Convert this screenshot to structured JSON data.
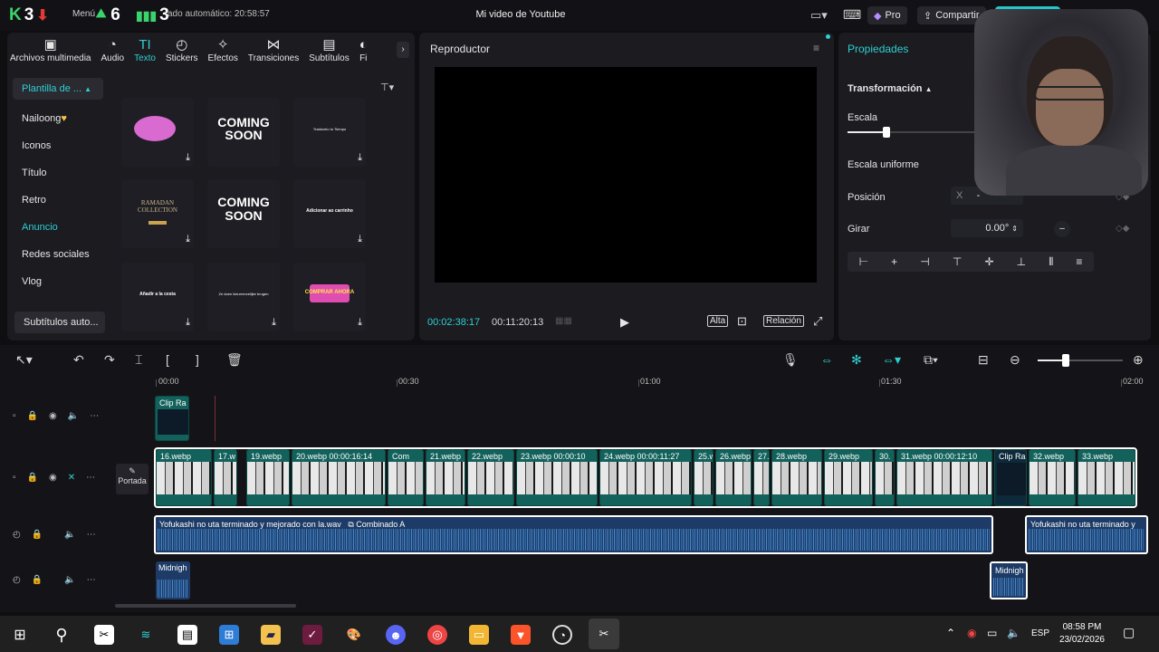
{
  "titlebar": {
    "title": "Mi video de Youtube",
    "autosave": "ado automático: 20:58:57",
    "menu": "Menú",
    "pro": "Pro",
    "share": "Compartir"
  },
  "overlay": {
    "k_num": "3",
    "up_num": "6",
    "bars_num": "3"
  },
  "media": {
    "tabs": [
      {
        "label": "Archivos multimedia",
        "icon": "media-icon"
      },
      {
        "label": "Audio",
        "icon": "audio-icon"
      },
      {
        "label": "Texto",
        "icon": "text-icon"
      },
      {
        "label": "Stickers",
        "icon": "sticker-icon"
      },
      {
        "label": "Efectos",
        "icon": "effects-icon"
      },
      {
        "label": "Transiciones",
        "icon": "transition-icon"
      },
      {
        "label": "Subtítulos",
        "icon": "subtitle-icon"
      },
      {
        "label": "Fi",
        "icon": "filter-icon"
      }
    ],
    "categories": [
      "Plantilla de ...",
      "Nailoong",
      "Iconos",
      "Título",
      "Retro",
      "Anuncio",
      "Redes sociales",
      "Vlog",
      "Subtítulos auto..."
    ],
    "tiles": [
      {
        "text": "",
        "kind": "pink-bubble"
      },
      {
        "text": "COMING SOON",
        "kind": "coming-soon"
      },
      {
        "text": "Tradúcelo tu Tiempo",
        "kind": "small"
      },
      {
        "text": "RAMADAN COLLECTION",
        "kind": "ramadan"
      },
      {
        "text": "COMING SOON",
        "kind": "coming-soon-2"
      },
      {
        "text": "Adicionar ao carrinho",
        "kind": "small"
      },
      {
        "text": "Añadir a la cesta",
        "kind": "small"
      },
      {
        "text": "Ze doen kleurrenvelijke brugen",
        "kind": "small"
      },
      {
        "text": "COMPRAR AHORA",
        "kind": "buy"
      }
    ]
  },
  "player": {
    "title": "Reproductor",
    "current_time": "00:02:38:17",
    "total_time": "00:11:20:13",
    "quality": "Alta",
    "ratio": "Relación"
  },
  "properties": {
    "title": "Propiedades",
    "section": "Transformación",
    "scale_label": "Escala",
    "scale_value": 0.27,
    "uniform_label": "Escala uniforme",
    "position_label": "Posición",
    "pos_x_label": "X",
    "pos_x_value": "-",
    "rotate_label": "Girar",
    "rotate_value": "0.00°"
  },
  "timeline": {
    "ruler": [
      "00:00",
      "00:30",
      "01:00",
      "01:30",
      "02:00"
    ],
    "zoom_level": 0.33,
    "portada_label": "Portada",
    "overlay_clip": "Clip Ra",
    "video_clips": [
      {
        "label": "16.webp"
      },
      {
        "label": "17.w"
      },
      {
        "label": "19.webp"
      },
      {
        "label": "20.webp  00:00:16:14"
      },
      {
        "label": "Com"
      },
      {
        "label": "21.webp"
      },
      {
        "label": "22.webp"
      },
      {
        "label": "23.webp  00:00:10"
      },
      {
        "label": "24.webp  00:00:11:27"
      },
      {
        "label": "25.webp"
      },
      {
        "label": "26.webp"
      },
      {
        "label": "27."
      },
      {
        "label": "28.webp"
      },
      {
        "label": "29.webp"
      },
      {
        "label": "30."
      },
      {
        "label": "31.webp  00:00:12:10"
      },
      {
        "label": "Clip Ra"
      },
      {
        "label": "32.webp"
      },
      {
        "label": "33.webp"
      }
    ],
    "audio_main": {
      "label": "Yofukashi no uta terminado y mejorado con la.wav",
      "combined": "Combinado A"
    },
    "audio_main_2": "Yofukashi no uta terminado y",
    "audio_2a": "Midnigh",
    "audio_2b": "Midnigh"
  },
  "taskbar": {
    "lang": "ESP",
    "time": "08:58 PM",
    "date": "23/02/2026"
  }
}
